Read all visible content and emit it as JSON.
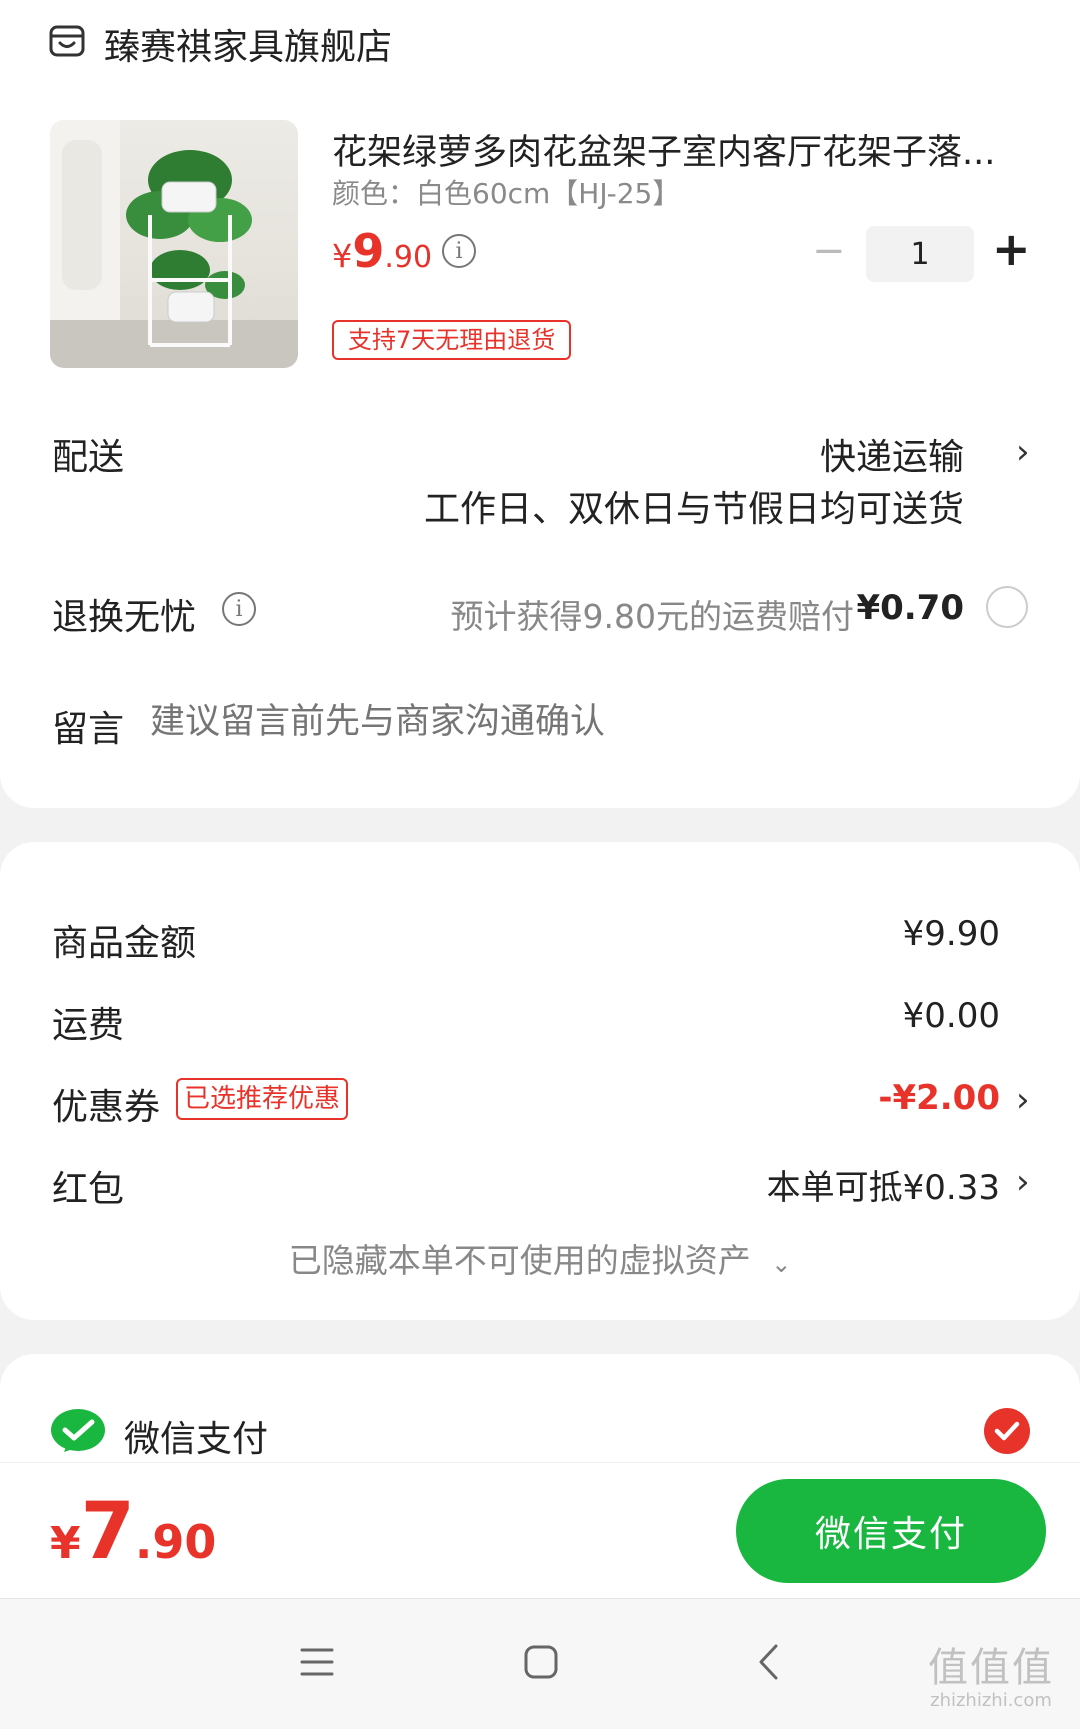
{
  "shop": {
    "icon": "shop-icon",
    "name": "臻赛祺家具旗舰店"
  },
  "product": {
    "image": "flower-stand-product-image",
    "title": "花架绿萝多肉花盆架子室内客厅花架子落...",
    "spec": "颜色：白色60cm【HJ-25】",
    "price_symbol": "¥",
    "price_int": "9",
    "price_dec": ".90",
    "quantity": "1",
    "minus": "−",
    "plus": "+",
    "return_tag": "支持7天无理由退货"
  },
  "delivery": {
    "label": "配送",
    "method": "快递运输",
    "note": "工作日、双休日与节假日均可送货"
  },
  "return_insurance": {
    "label": "退换无忧",
    "desc": "预计获得9.80元的运费赔付",
    "price": "¥0.70"
  },
  "message": {
    "label": "留言",
    "placeholder": "建议留言前先与商家沟通确认"
  },
  "summary": {
    "goods_label": "商品金额",
    "goods_value": "¥9.90",
    "shipping_label": "运费",
    "shipping_value": "¥0.00",
    "coupon_label": "优惠券",
    "coupon_tag": "已选推荐优惠",
    "coupon_value": "-¥2.00",
    "redpacket_label": "红包",
    "redpacket_value": "本单可抵¥0.33",
    "hidden_assets": "已隐藏本单不可使用的虚拟资产"
  },
  "payment": {
    "method": "微信支付",
    "icon": "wechat-pay-icon"
  },
  "footer": {
    "total_symbol": "¥",
    "total_int": "7",
    "total_dec": ".90",
    "button": "微信支付"
  },
  "colors": {
    "accent_green": "#19b640",
    "price_red": "#e8332b"
  },
  "watermark": {
    "text": "值值值",
    "url": "zhizhizhi.com"
  }
}
